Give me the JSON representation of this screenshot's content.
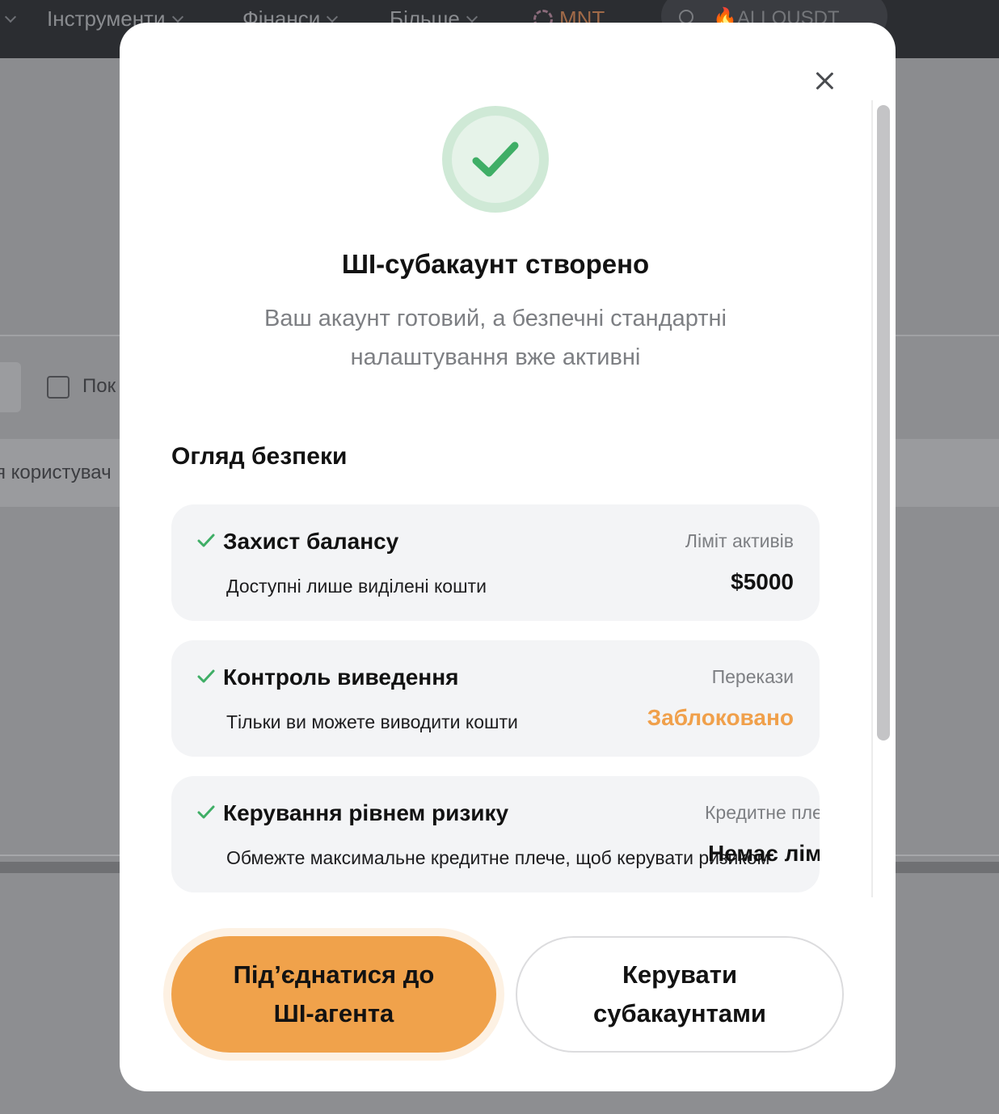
{
  "background": {
    "nav": {
      "items": [
        "Інструменти",
        "Фінанси",
        "Більше"
      ],
      "token": "MNT",
      "search_text": "🔥ALLOUSDT"
    },
    "checkbox_label": "Пок",
    "table_header_fragment": "я користувач"
  },
  "modal": {
    "title": "ШІ-субакаунт створено",
    "subtitle": "Ваш акаунт готовий, а безпечні стандартні налаштування вже активні",
    "section_title": "Огляд безпеки",
    "cards": [
      {
        "title": "Захист балансу",
        "description": "Доступні лише виділені кошти",
        "label": "Ліміт активів",
        "value": "$5000",
        "value_color": "#121212"
      },
      {
        "title": "Контроль виведення",
        "description": "Тільки ви можете виводити кошти",
        "label": "Перекази",
        "value": "Заблоковано",
        "value_color": "#f0a04b"
      },
      {
        "title": "Керування рівнем ризику",
        "description": "Обмежте максимальне кредитне плече, щоб керувати ризиком",
        "label": "Кредитне плече",
        "value": "Немає ліміту",
        "value_color": "#121212"
      }
    ],
    "primary_button": "Під’єднатися до ШІ-агента",
    "secondary_button": "Керувати субакаунтами"
  },
  "colors": {
    "accent": "#f0a24b",
    "success": "#3fae66",
    "overlay": "#8d8e91"
  },
  "icons": [
    "close-icon",
    "check-circle-icon",
    "check-icon",
    "search-icon",
    "chevron-down-icon"
  ]
}
